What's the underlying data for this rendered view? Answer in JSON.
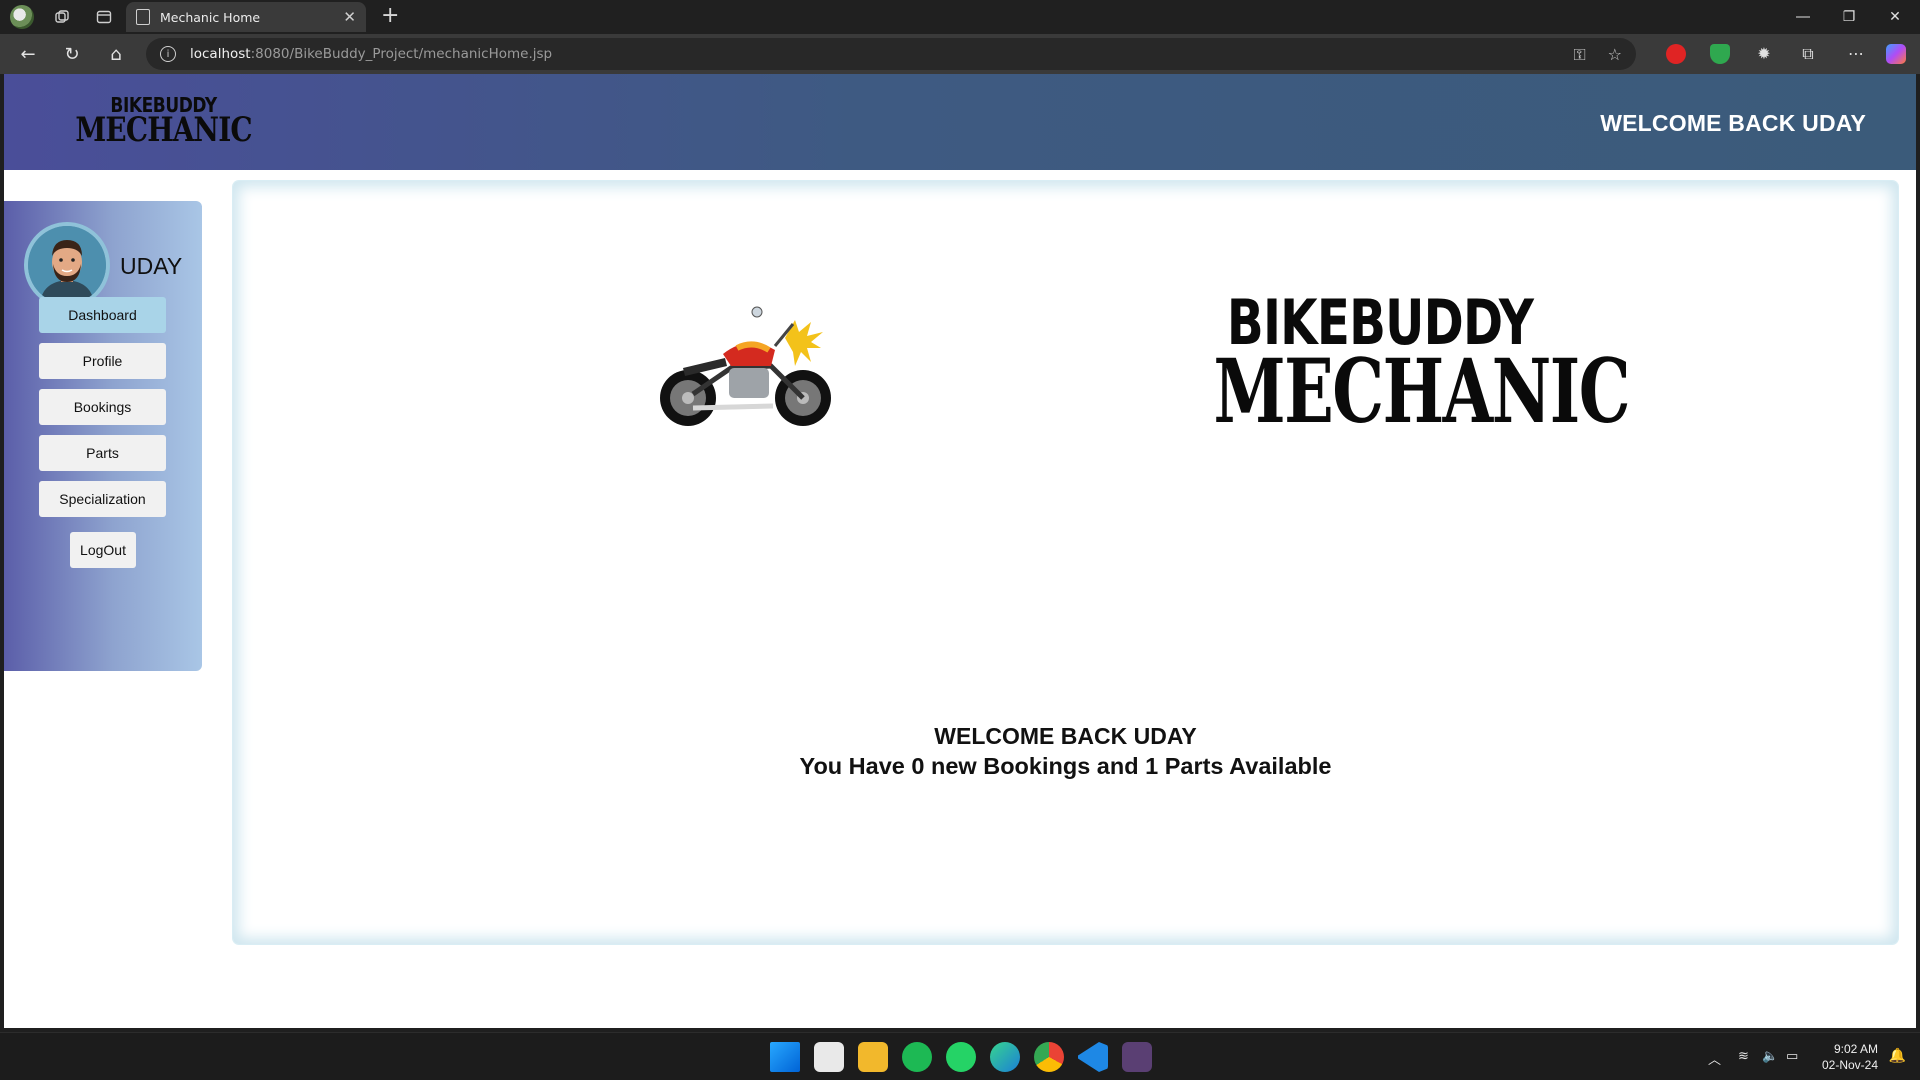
{
  "browser": {
    "tab_title": "Mechanic Home",
    "url_host": "localhost",
    "url_rest": ":8080/BikeBuddy_Project/mechanicHome.jsp",
    "new_tab": "+",
    "tab_close": "✕"
  },
  "header": {
    "logo_line1": "BIKEBUDDY",
    "logo_line2": "MECHANIC",
    "welcome": "WELCOME BACK UDAY"
  },
  "sidebar": {
    "username": "UDAY",
    "items": [
      {
        "label": "Dashboard",
        "active": true
      },
      {
        "label": "Profile"
      },
      {
        "label": "Bookings"
      },
      {
        "label": "Parts"
      },
      {
        "label": "Specialization"
      }
    ],
    "logout": "LogOut"
  },
  "main": {
    "logo_line1": "BIKEBUDDY",
    "logo_line2": "MECHANIC",
    "welcome_title": "WELCOME BACK UDAY",
    "summary": "You Have 0 new Bookings and 1 Parts Available"
  },
  "taskbar": {
    "time": "9:02 AM",
    "date": "02-Nov-24"
  }
}
